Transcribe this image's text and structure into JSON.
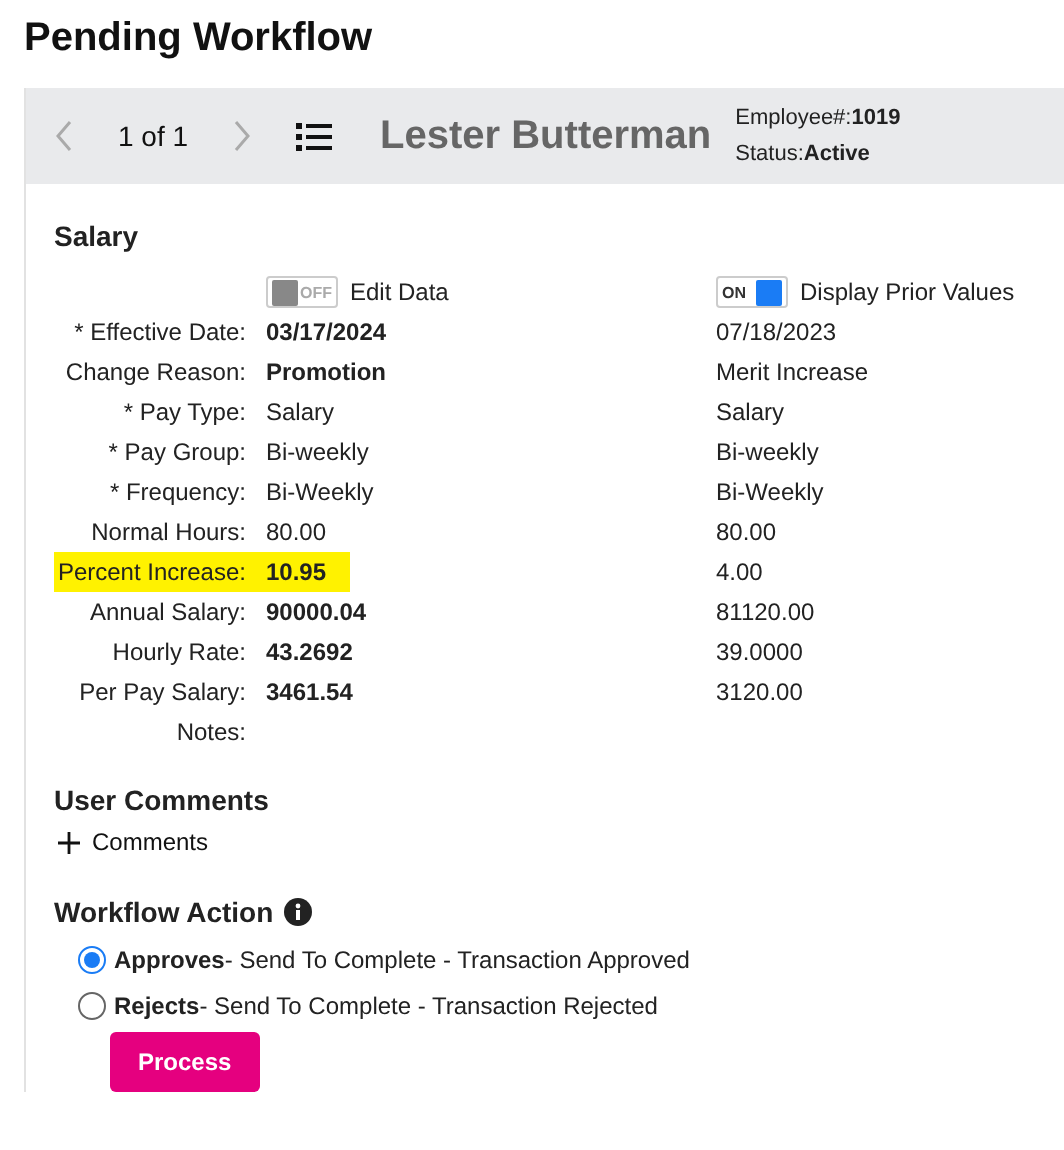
{
  "page_title": "Pending Workflow",
  "header": {
    "pager": "1 of 1",
    "employee_name": "Lester Butterman",
    "employee_number_label": "Employee#:",
    "employee_number": "1019",
    "status_label": "Status:",
    "status": "Active"
  },
  "salary": {
    "heading": "Salary",
    "toggles": [
      {
        "switch_text": "OFF",
        "label": "Edit Data",
        "on": false
      },
      {
        "switch_text": "ON",
        "label": "Display Prior Values",
        "on": true
      }
    ],
    "rows": [
      {
        "label": "* Effective Date:",
        "value": "03/17/2024",
        "bold": true,
        "highlighted": false,
        "prior": "07/18/2023"
      },
      {
        "label": "Change Reason:",
        "value": "Promotion",
        "bold": true,
        "highlighted": false,
        "prior": "Merit Increase"
      },
      {
        "label": "* Pay Type:",
        "value": "Salary",
        "bold": false,
        "highlighted": false,
        "prior": "Salary"
      },
      {
        "label": "* Pay Group:",
        "value": "Bi-weekly",
        "bold": false,
        "highlighted": false,
        "prior": "Bi-weekly"
      },
      {
        "label": "* Frequency:",
        "value": "Bi-Weekly",
        "bold": false,
        "highlighted": false,
        "prior": "Bi-Weekly"
      },
      {
        "label": "Normal Hours:",
        "value": "80.00",
        "bold": false,
        "highlighted": false,
        "prior": "80.00"
      },
      {
        "label": "Percent Increase:",
        "value": "10.95",
        "bold": true,
        "highlighted": true,
        "prior": "4.00"
      },
      {
        "label": "Annual Salary:",
        "value": "90000.04",
        "bold": true,
        "highlighted": false,
        "prior": "81120.00"
      },
      {
        "label": "Hourly Rate:",
        "value": "43.2692",
        "bold": true,
        "highlighted": false,
        "prior": "39.0000"
      },
      {
        "label": "Per Pay Salary:",
        "value": "3461.54",
        "bold": true,
        "highlighted": false,
        "prior": "3120.00"
      },
      {
        "label": "Notes:",
        "highlighted": false
      }
    ]
  },
  "user_comments": {
    "heading": "User Comments",
    "add_label": "Comments"
  },
  "workflow_action": {
    "heading": "Workflow Action",
    "options": [
      {
        "text": "**Approves**- Send To Complete - Transaction Approved",
        "selected": true
      },
      {
        "text": "**Rejects**- Send To Complete - Transaction Rejected",
        "selected": false
      }
    ],
    "button": "Process"
  }
}
